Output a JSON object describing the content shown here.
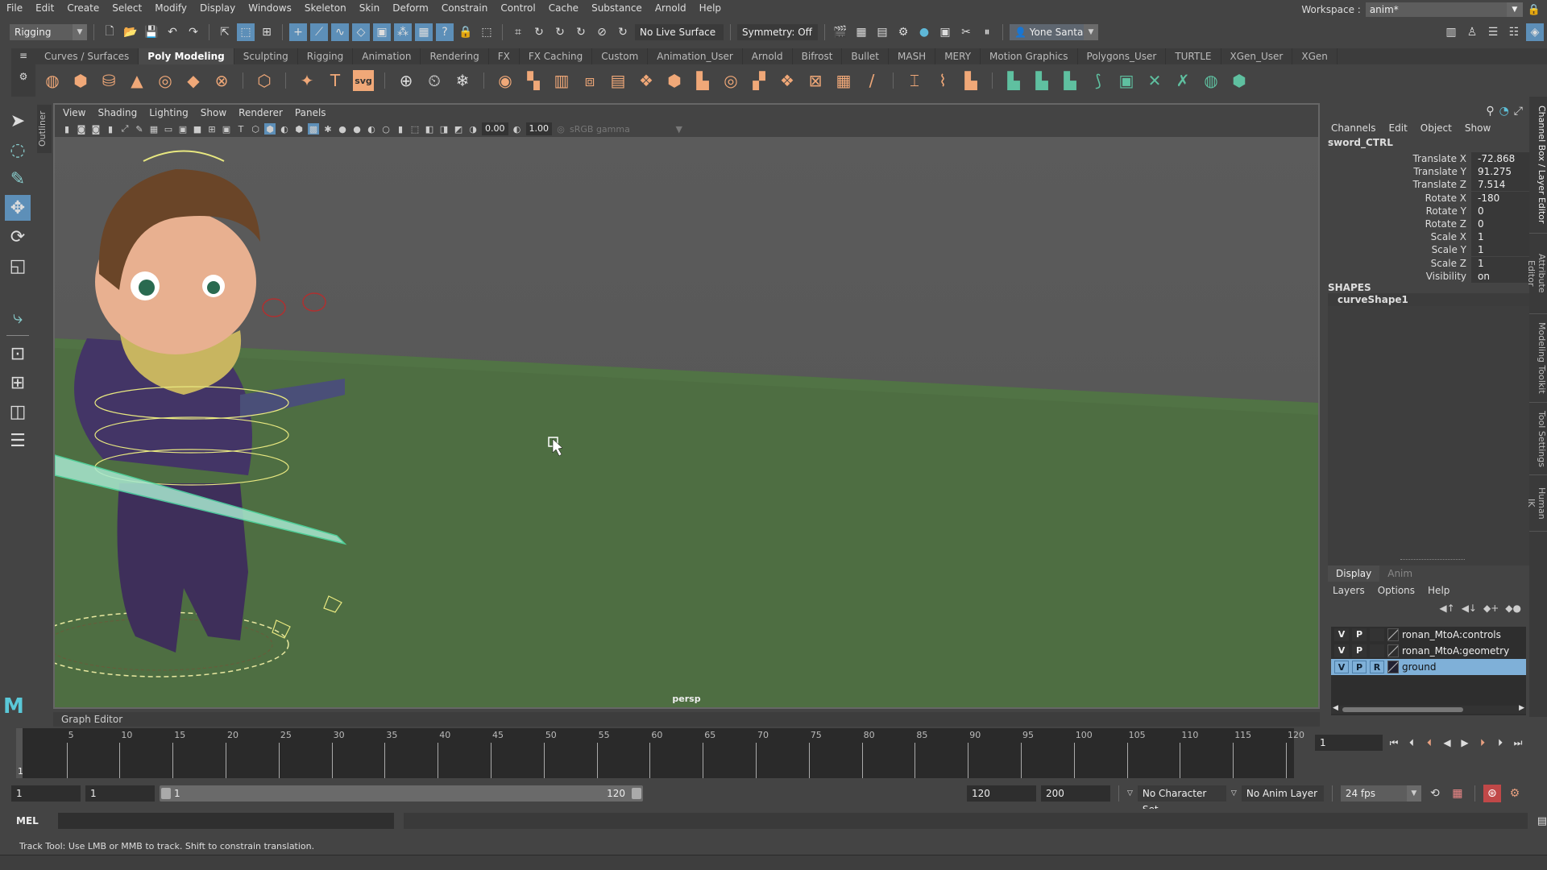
{
  "menubar": {
    "items": [
      "File",
      "Edit",
      "Create",
      "Select",
      "Modify",
      "Display",
      "Windows",
      "Skeleton",
      "Skin",
      "Deform",
      "Constrain",
      "Control",
      "Cache",
      "Substance",
      "Arnold",
      "Help"
    ],
    "workspace_label": "Workspace :",
    "workspace_value": "anim*"
  },
  "statusline": {
    "menuset": "Rigging",
    "live_surface": "No Live Surface",
    "symmetry": "Symmetry: Off",
    "user": "Yone Santana"
  },
  "shelf": {
    "tabs": [
      "Curves / Surfaces",
      "Poly Modeling",
      "Sculpting",
      "Rigging",
      "Animation",
      "Rendering",
      "FX",
      "FX Caching",
      "Custom",
      "Animation_User",
      "Arnold",
      "Bifrost",
      "Bullet",
      "MASH",
      "MERY",
      "Motion Graphics",
      "Polygons_User",
      "TURTLE",
      "XGen_User",
      "XGen"
    ],
    "active_tab": "Poly Modeling",
    "icons": [
      "poly-sphere-icon",
      "poly-cube-icon",
      "poly-cylinder-icon",
      "poly-cone-icon",
      "poly-torus-icon",
      "poly-plane-icon",
      "poly-disc-icon",
      "platonic-solid-icon",
      "super-shape-icon",
      "poly-type-icon",
      "svg-icon",
      "sweep-mesh-icon",
      "history-icon",
      "freeze-transform-icon",
      "combine-icon",
      "separate-icon",
      "bevel-icon",
      "extrude-icon",
      "bridge-icon",
      "bool-icon",
      "smooth-icon",
      "reduce-icon",
      "mirror-icon",
      "cleanup-icon",
      "triangulate-icon",
      "quadrangulate-icon",
      "fill-hole-icon",
      "append-icon",
      "multicut-icon",
      "target-weld-icon",
      "connect-icon",
      "uv-editor-icon",
      "unfold-icon",
      "layout-icon",
      "planar-uv-icon",
      "cylindrical-uv-icon",
      "spherical-uv-icon",
      "auto-uv-icon",
      "cut-uv-icon",
      "sew-uv-icon"
    ],
    "svg_label": "svg"
  },
  "toolbox": {
    "tools": [
      "select-tool-icon",
      "lasso-tool-icon",
      "paint-select-tool-icon",
      "move-tool-icon",
      "rotate-tool-icon",
      "scale-tool-icon",
      "joint-tool-icon",
      "single-perspective-layout-icon",
      "four-view-layout-icon",
      "two-view-layout-icon",
      "outliner-layout-icon"
    ],
    "active": "move-tool-icon",
    "outliner_tab": "Outliner"
  },
  "viewport": {
    "menu": [
      "View",
      "Shading",
      "Lighting",
      "Show",
      "Renderer",
      "Panels"
    ],
    "exposure": "0.00",
    "gamma": "1.00",
    "color_space": "sRGB gamma",
    "camera_label": "persp",
    "scene_object": "sword_CTRL"
  },
  "channel_box": {
    "menu": [
      "Channels",
      "Edit",
      "Object",
      "Show"
    ],
    "node": "sword_CTRL",
    "channels": [
      {
        "label": "Translate X",
        "value": "-72.868"
      },
      {
        "label": "Translate Y",
        "value": "91.275"
      },
      {
        "label": "Translate Z",
        "value": "7.514"
      },
      {
        "label": "Rotate X",
        "value": "-180"
      },
      {
        "label": "Rotate Y",
        "value": "0"
      },
      {
        "label": "Rotate Z",
        "value": "0"
      },
      {
        "label": "Scale X",
        "value": "1"
      },
      {
        "label": "Scale Y",
        "value": "1"
      },
      {
        "label": "Scale Z",
        "value": "1"
      },
      {
        "label": "Visibility",
        "value": "on"
      }
    ],
    "shapes_title": "SHAPES",
    "shape": "curveShape1"
  },
  "layer_editor": {
    "tabs": [
      "Display",
      "Anim"
    ],
    "active_tab": "Display",
    "menu": [
      "Layers",
      "Options",
      "Help"
    ],
    "layers": [
      {
        "v": "V",
        "p": "P",
        "r": "",
        "name": "ronan_MtoA:controls",
        "selected": false
      },
      {
        "v": "V",
        "p": "P",
        "r": "",
        "name": "ronan_MtoA:geometry",
        "selected": false
      },
      {
        "v": "V",
        "p": "P",
        "r": "R",
        "name": "ground",
        "selected": true
      }
    ]
  },
  "side_tabs": [
    "Channel Box / Layer Editor",
    "Attribute Editor",
    "Modeling Toolkit",
    "Tool Settings",
    "Human IK"
  ],
  "graph_editor_label": "Graph Editor",
  "timeline": {
    "ticks": [
      "5",
      "10",
      "15",
      "20",
      "25",
      "30",
      "35",
      "40",
      "45",
      "50",
      "55",
      "60",
      "65",
      "70",
      "75",
      "80",
      "85",
      "90",
      "95",
      "100",
      "105",
      "110",
      "115",
      "120"
    ],
    "current_frame": "1",
    "current_frame_field": "1"
  },
  "range": {
    "start": "1",
    "anim_start": "1",
    "slider_start": "1",
    "slider_end": "120",
    "end": "120",
    "anim_end": "200",
    "character_set": "No Character Set",
    "anim_layer": "No Anim Layer",
    "fps": "24 fps"
  },
  "command_line": {
    "label": "MEL"
  },
  "help_line": "Track Tool: Use LMB or MMB to track. Shift to constrain translation."
}
